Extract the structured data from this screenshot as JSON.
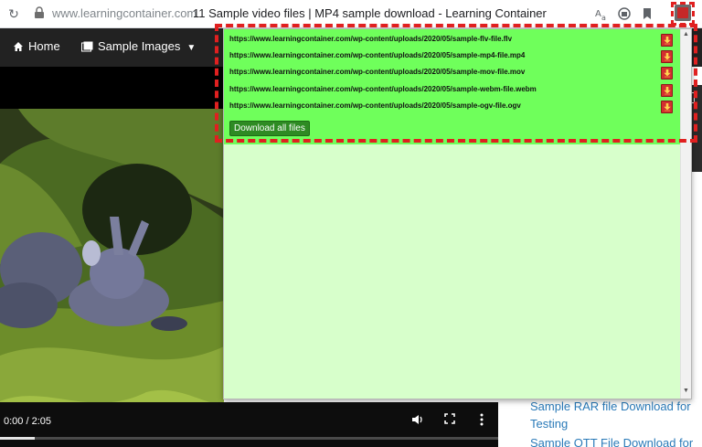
{
  "browser": {
    "url_host": "www.learningcontainer.com",
    "page_title": "11 Sample video files | MP4 sample download - Learning Container"
  },
  "nav": {
    "home": "Home",
    "sample_images": "Sample Images"
  },
  "video": {
    "time": "0:00 / 2:05",
    "progress_fraction": 0.07
  },
  "sidebar": {
    "links": [
      "Sample RAR file Download for",
      "Testing",
      "Sample OTT File Download for"
    ]
  },
  "popup": {
    "files": [
      "https://www.learningcontainer.com/wp-content/uploads/2020/05/sample-flv-file.flv",
      "https://www.learningcontainer.com/wp-content/uploads/2020/05/sample-mp4-file.mp4",
      "https://www.learningcontainer.com/wp-content/uploads/2020/05/sample-mov-file.mov",
      "https://www.learningcontainer.com/wp-content/uploads/2020/05/sample-webm-file.webm",
      "https://www.learningcontainer.com/wp-content/uploads/2020/05/sample-ogv-file.ogv"
    ],
    "download_all": "Download all files"
  },
  "colors": {
    "popup_highlight": "#6fff5b",
    "popup_bg": "#d7ffcb",
    "download_all_bg": "#2e8b23",
    "link": "#2a7ab8",
    "dashed_outline": "#e02020"
  },
  "icons": [
    "reload-icon",
    "lock-icon",
    "translate-icon",
    "extension-icon",
    "bookmark-icon",
    "download-extension-icon",
    "home-icon",
    "images-icon",
    "chevron-down-icon",
    "volume-icon",
    "fullscreen-icon",
    "more-icon"
  ]
}
